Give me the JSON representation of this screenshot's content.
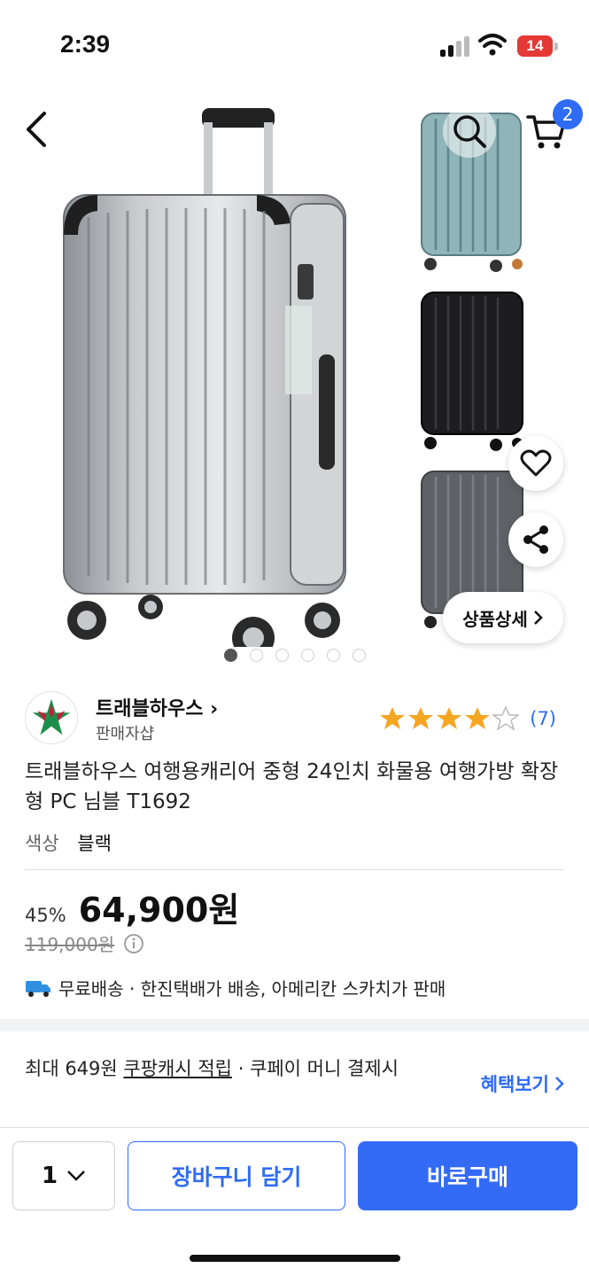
{
  "status_bar": {
    "time": "2:39",
    "battery": "14"
  },
  "header": {
    "cart_count": "2"
  },
  "gallery": {
    "detail_label": "상품상세",
    "page_count": 6,
    "active_page": 1,
    "thumbnails": [
      {
        "color": "#7fa9b0",
        "name": "mint"
      },
      {
        "color": "#1c1c1c",
        "name": "black"
      },
      {
        "color": "#5d5f64",
        "name": "gray"
      }
    ]
  },
  "seller": {
    "name": "트래블하우스",
    "subtitle": "판매자샵",
    "rating": 4,
    "rating_max": 5,
    "review_count": "(7)"
  },
  "product": {
    "title": "트래블하우스 여행용캐리어 중형 24인치 화물용 여행가방 확장형 PC 님블 T1692",
    "option_label": "색상",
    "option_value": "블랙"
  },
  "price": {
    "discount": "45%",
    "sale_price": "64,900원",
    "original_price": "119,000원"
  },
  "shipping": {
    "free_label": "무료배송",
    "detail": " · 한진택배가 배송, 아메리칸 스카치가 판매"
  },
  "cash": {
    "prefix": "최대 649원 ",
    "underlined": "쿠팡캐시 적립",
    "suffix": " · 쿠페이 머니 결제시",
    "benefit_link": "혜택보기"
  },
  "bottom_bar": {
    "quantity": "1",
    "add_to_cart": "장바구니 담기",
    "buy_now": "바로구매"
  },
  "colors": {
    "accent": "#346bf6",
    "star": "#f5a623",
    "danger": "#e53935"
  }
}
